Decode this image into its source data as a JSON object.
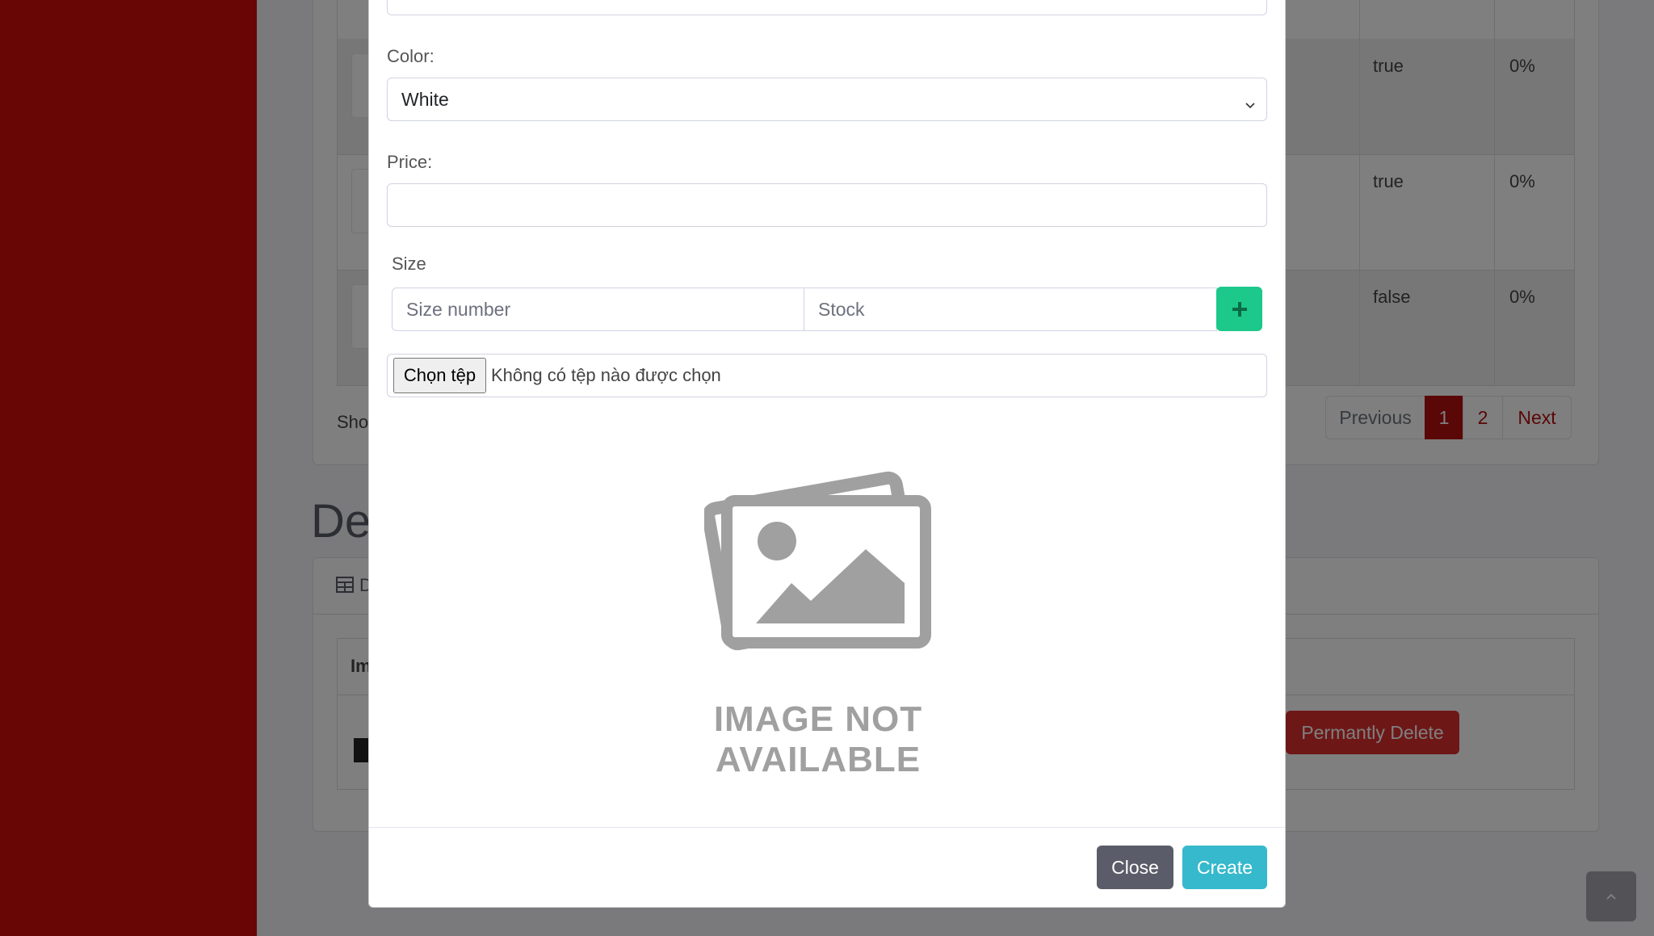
{
  "background": {
    "rows": [
      {
        "active": "true",
        "discount": "0%"
      },
      {
        "active": "true",
        "discount": "0%"
      },
      {
        "active": "false",
        "discount": "0%"
      }
    ],
    "show_prefix": "Sho",
    "section_title_partial": "De",
    "table_head_partial": "Im",
    "card_header_partial": "D",
    "pagination": {
      "previous": "Previous",
      "page1": "1",
      "page2": "2",
      "next": "Next"
    },
    "permanently_delete": "Permantly Delete"
  },
  "modal": {
    "color_label": "Color:",
    "color_value": "White",
    "price_label": "Price:",
    "price_value": "",
    "size_label": "Size",
    "size_placeholder": "Size number",
    "stock_placeholder": "Stock",
    "file_button": "Chọn tệp",
    "file_status": "Không có tệp nào được chọn",
    "image_placeholder_text": "IMAGE NOT AVAILABLE",
    "close_label": "Close",
    "create_label": "Create"
  },
  "colors": {
    "sidebar": "#d10d0d",
    "primary": "#b50e0e",
    "success": "#1cc88a",
    "info": "#36b9cc",
    "secondary": "#5a5c69",
    "danger": "#dc2f2f"
  },
  "icons": [
    "plus-icon",
    "chevron-down-icon",
    "image-placeholder-icon",
    "table-icon",
    "arrow-up-icon"
  ]
}
